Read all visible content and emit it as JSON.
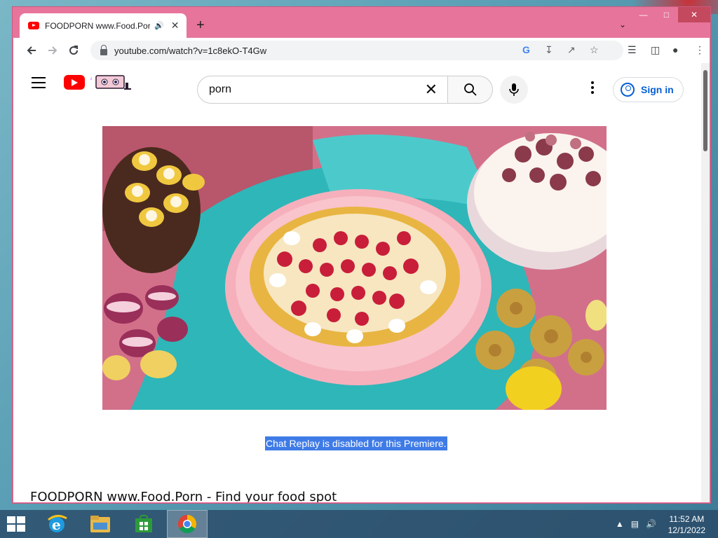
{
  "browser": {
    "tab": {
      "title": "FOODPORN www.Food.Porn - Find your food spot",
      "audio_icon": "speaker-icon"
    },
    "url": "youtube.com/watch?v=1c8ekO-T4Gw"
  },
  "youtube": {
    "search": {
      "query": "porn"
    },
    "signin_label": "Sign in",
    "chat_replay_message": "Chat Replay is disabled for this Premiere.",
    "video_title": "FOODPORN www.Food.Porn - Find your food spot"
  },
  "taskbar": {
    "apps": [
      "internet-explorer",
      "file-explorer",
      "store",
      "chrome"
    ],
    "time": "11:52 AM",
    "date": "12/1/2022"
  },
  "colors": {
    "window_frame": "#e7749a",
    "youtube_red": "#ff0000",
    "link_blue": "#065fd4",
    "selection": "#3f7be6"
  }
}
